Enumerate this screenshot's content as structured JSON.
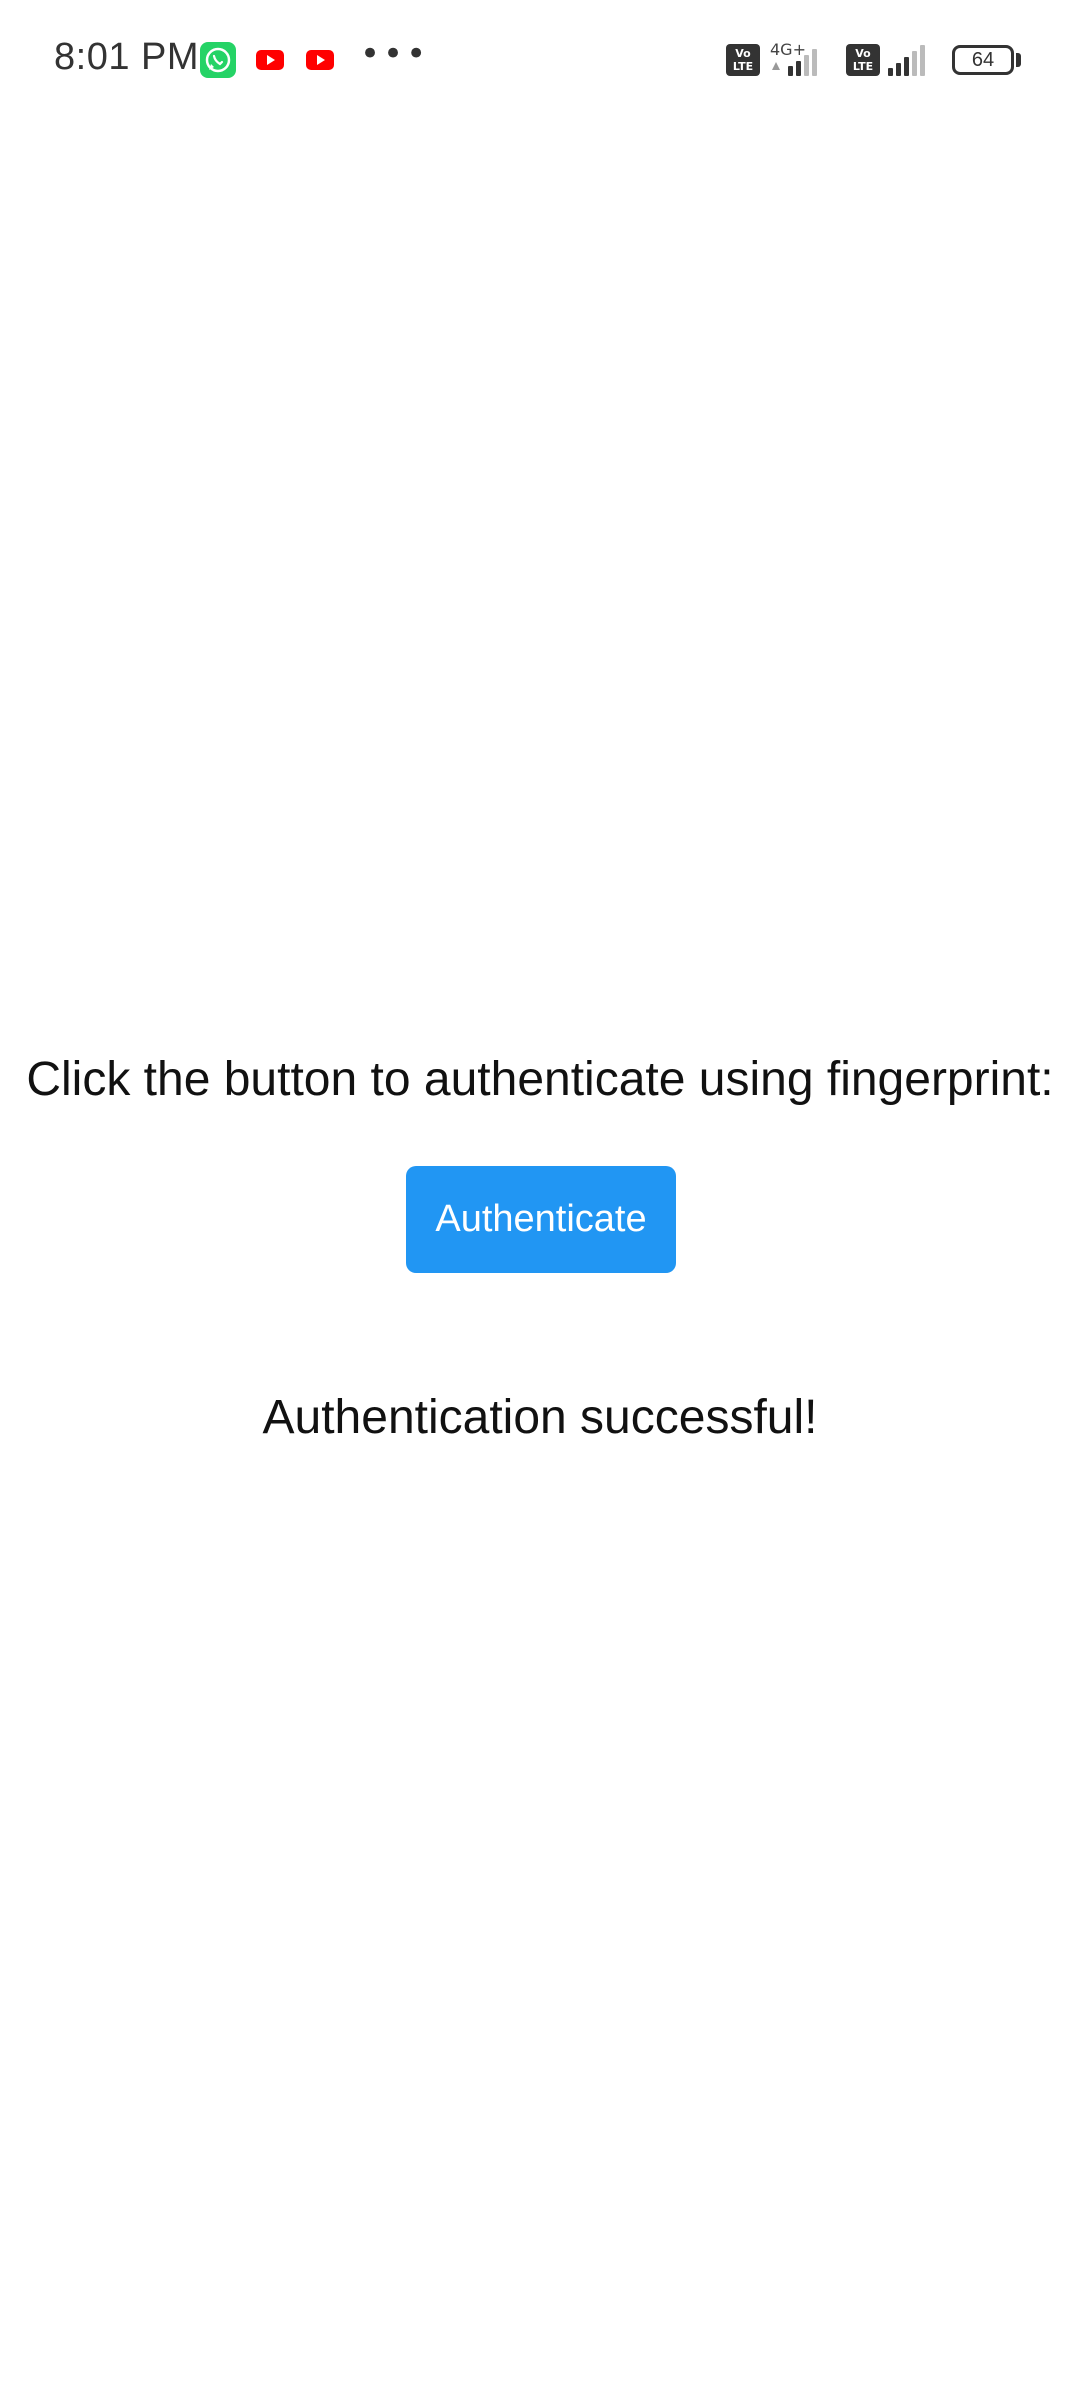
{
  "status_bar": {
    "time": "8:01 PM",
    "notifications": [
      "whatsapp-icon",
      "youtube-icon",
      "youtube-icon"
    ],
    "overflow": "•••",
    "sim1": {
      "volte_label": "Vo\nLTE",
      "network": "4G+"
    },
    "sim2": {
      "volte_label": "Vo\nLTE"
    },
    "battery": "64"
  },
  "colors": {
    "accent": "#2196f3",
    "whatsapp": "#25d366",
    "youtube": "#ff0000"
  },
  "main": {
    "prompt": "Click the button to authenticate using fingerprint:",
    "button_label": "Authenticate",
    "result": "Authentication successful!"
  }
}
